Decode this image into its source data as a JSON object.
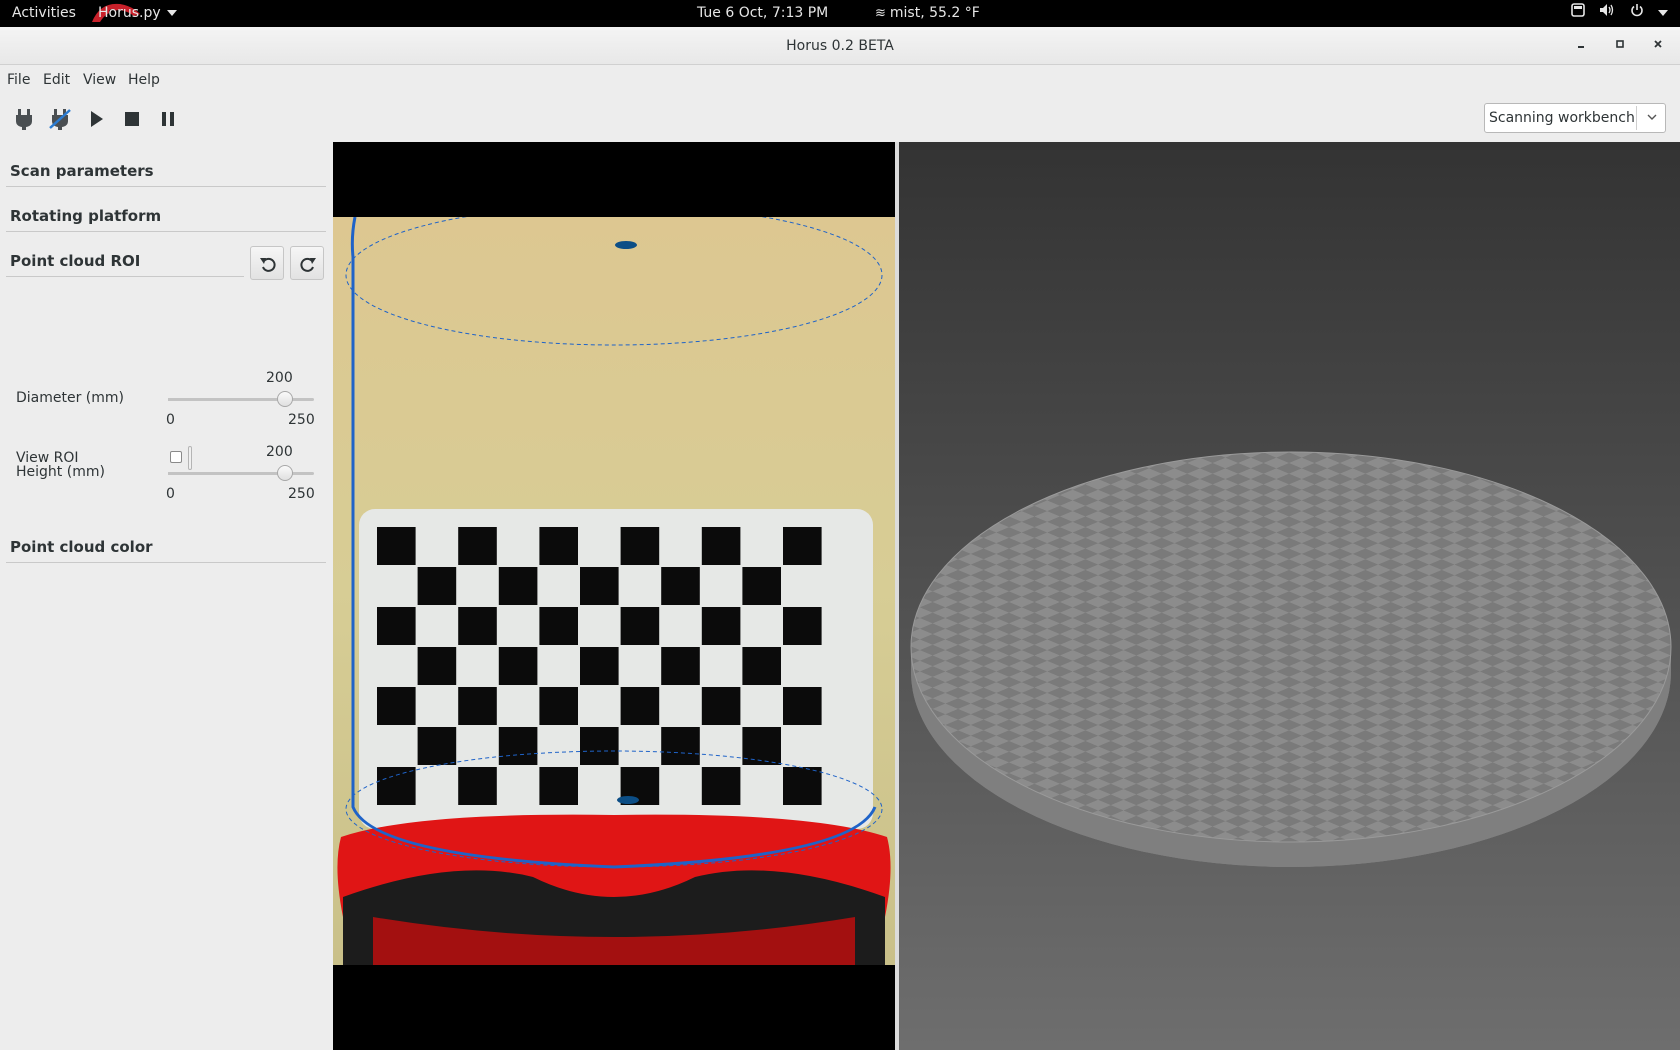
{
  "topbar": {
    "activities": "Activities",
    "app_menu": "Horus.py",
    "clock": "Tue  6 Oct,  7:13 PM",
    "weather": "mist, 55.2 °F"
  },
  "window": {
    "title": "Horus 0.2 BETA"
  },
  "menubar": {
    "file": "File",
    "edit": "Edit",
    "view": "View",
    "help": "Help"
  },
  "toolbar": {
    "icons": [
      "connect-icon",
      "disconnect-icon",
      "play-icon",
      "stop-icon",
      "pause-icon"
    ],
    "workbench_selected": "Scanning workbench"
  },
  "panel": {
    "scan_parameters": "Scan parameters",
    "rotating_platform": "Rotating platform",
    "point_cloud_roi": "Point cloud ROI",
    "view_roi_label": "View ROI",
    "view_roi_checked": false,
    "diameter": {
      "label": "Diameter (mm)",
      "value": "200",
      "min": "0",
      "max": "250",
      "fraction": 0.8
    },
    "height": {
      "label": "Height (mm)",
      "value": "200",
      "min": "0",
      "max": "250",
      "fraction": 0.8
    },
    "point_cloud_color": "Point cloud color"
  },
  "colors": {
    "roi_outline": "#1f63c8",
    "platform_red": "#e01515",
    "scene_background": "#3a3a3a",
    "platform_grey": "#8a8a8a"
  }
}
